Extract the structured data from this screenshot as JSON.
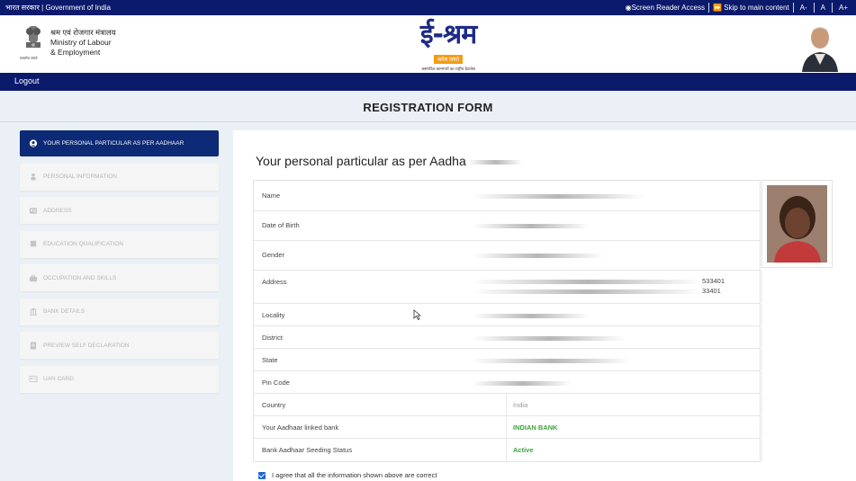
{
  "topbar": {
    "left_text": "भारत सरकार | Government of India",
    "screen_reader": "Screen Reader Access",
    "skip": "Skip to main content",
    "font_small": "A-",
    "font_normal": "A",
    "font_large": "A+"
  },
  "header": {
    "ministry_hindi": "श्रम एवं रोजगार मंत्रालय",
    "ministry_line1": "Ministry of Labour",
    "ministry_line2": "& Employment",
    "emblem_caption": "सत्यमेव जयते",
    "logo_text": "ई-श्रम",
    "logo_tag": "श्रमेव जयते",
    "logo_subtitle": "असंगठित कामगारों का राष्ट्रीय डेटाबेस"
  },
  "nav": {
    "logout": "Logout"
  },
  "page": {
    "title": "REGISTRATION FORM"
  },
  "sidebar": {
    "items": [
      {
        "label": "YOUR PERSONAL PARTICULAR AS PER AADHAAR",
        "icon": "user-circle-icon"
      },
      {
        "label": "PERSONAL INFORMATION",
        "icon": "person-icon"
      },
      {
        "label": "ADDRESS",
        "icon": "address-card-icon"
      },
      {
        "label": "EDUCATION QUALIFICATION",
        "icon": "book-icon"
      },
      {
        "label": "OCCUPATION AND SKILLS",
        "icon": "briefcase-icon"
      },
      {
        "label": "BANK DETAILS",
        "icon": "bank-icon"
      },
      {
        "label": "PREVIEW SELF DECLARATION",
        "icon": "document-icon"
      },
      {
        "label": "UAN CARD",
        "icon": "id-card-icon"
      }
    ]
  },
  "main": {
    "title": "Your personal particular as per Aadha",
    "rows": [
      {
        "label": "Name",
        "value": ""
      },
      {
        "label": "Date of Birth",
        "value": ""
      },
      {
        "label": "Gender",
        "value": ""
      },
      {
        "label": "Address",
        "value": "533401",
        "value2": "33401"
      },
      {
        "label": "Locality",
        "value": ""
      },
      {
        "label": "District",
        "value": ""
      },
      {
        "label": "State",
        "value": ""
      },
      {
        "label": "Pin Code",
        "value": ""
      },
      {
        "label": "Country",
        "value": "India"
      },
      {
        "label": "Your Aadhaar linked bank",
        "value": "INDIAN BANK"
      },
      {
        "label": "Bank Aadhaar Seeding Status",
        "value": "Active"
      }
    ],
    "agree_text": "I agree that all the information shown above are correct"
  },
  "colors": {
    "navy": "#0c1a6b",
    "active_sidebar": "#0c2a75",
    "green_status": "#3aa53a",
    "logo_orange": "#f39c12"
  }
}
